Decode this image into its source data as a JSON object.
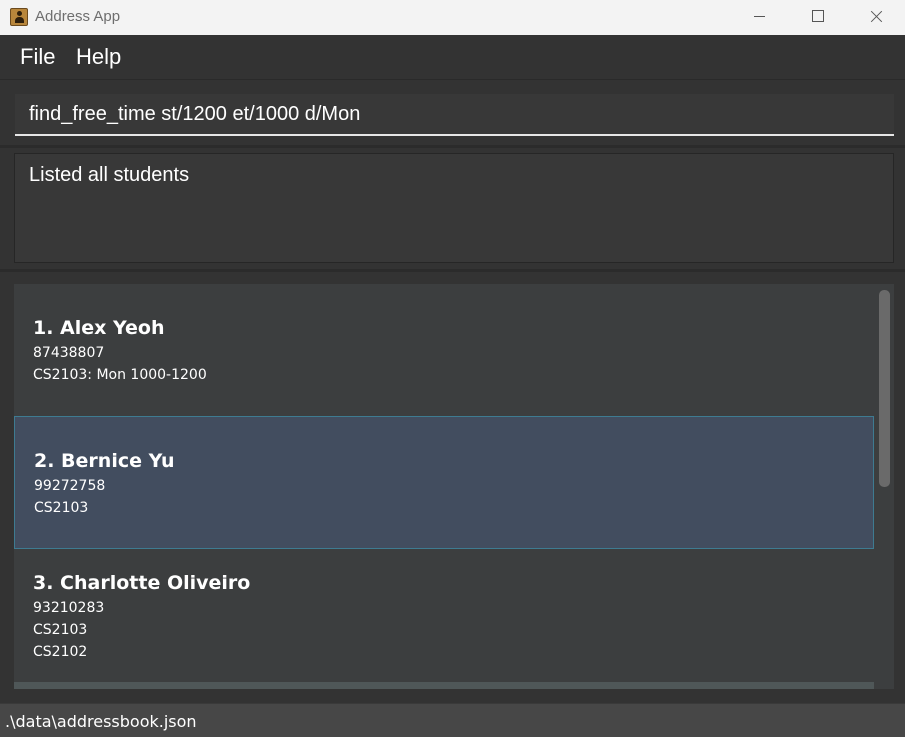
{
  "window": {
    "title": "Address App"
  },
  "menu": {
    "file_label": "File",
    "help_label": "Help"
  },
  "command": {
    "value": "find_free_time st/1200 et/1000 d/Mon"
  },
  "result": {
    "text": "Listed all students"
  },
  "persons": [
    {
      "index_name": "1.  Alex Yeoh",
      "lines": [
        "87438807",
        "CS2103: Mon 1000-1200"
      ]
    },
    {
      "index_name": "2.  Bernice Yu",
      "lines": [
        "99272758",
        "CS2103"
      ]
    },
    {
      "index_name": "3.  Charlotte Oliveiro",
      "lines": [
        "93210283",
        "CS2103",
        "CS2102"
      ]
    }
  ],
  "status": {
    "path": ".\\data\\addressbook.json"
  },
  "colors": {
    "selected_card": "#424d5f",
    "selected_border": "#3e7b91",
    "background": "#333333"
  }
}
